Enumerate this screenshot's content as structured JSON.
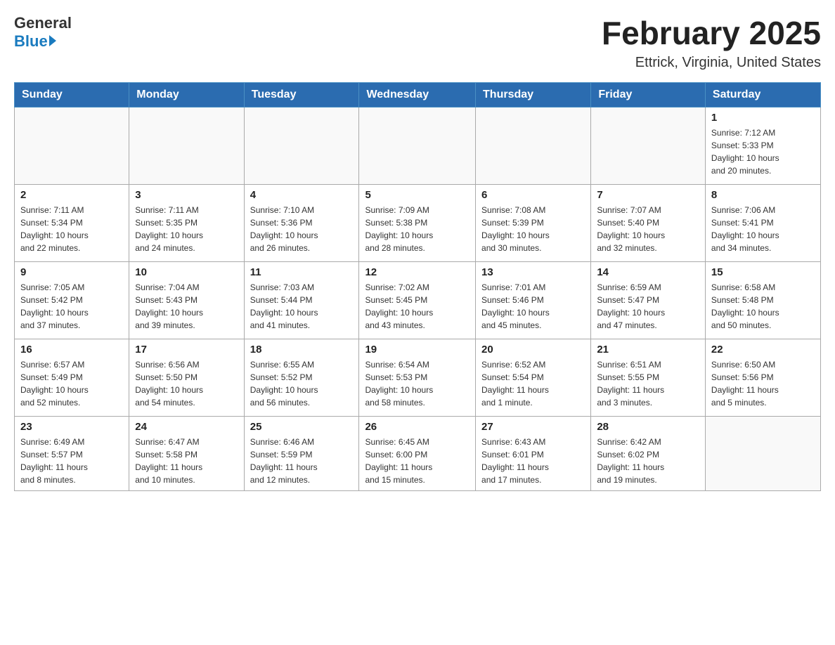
{
  "logo": {
    "general": "General",
    "blue": "Blue"
  },
  "title": "February 2025",
  "location": "Ettrick, Virginia, United States",
  "weekdays": [
    "Sunday",
    "Monday",
    "Tuesday",
    "Wednesday",
    "Thursday",
    "Friday",
    "Saturday"
  ],
  "weeks": [
    [
      {
        "day": "",
        "info": ""
      },
      {
        "day": "",
        "info": ""
      },
      {
        "day": "",
        "info": ""
      },
      {
        "day": "",
        "info": ""
      },
      {
        "day": "",
        "info": ""
      },
      {
        "day": "",
        "info": ""
      },
      {
        "day": "1",
        "info": "Sunrise: 7:12 AM\nSunset: 5:33 PM\nDaylight: 10 hours\nand 20 minutes."
      }
    ],
    [
      {
        "day": "2",
        "info": "Sunrise: 7:11 AM\nSunset: 5:34 PM\nDaylight: 10 hours\nand 22 minutes."
      },
      {
        "day": "3",
        "info": "Sunrise: 7:11 AM\nSunset: 5:35 PM\nDaylight: 10 hours\nand 24 minutes."
      },
      {
        "day": "4",
        "info": "Sunrise: 7:10 AM\nSunset: 5:36 PM\nDaylight: 10 hours\nand 26 minutes."
      },
      {
        "day": "5",
        "info": "Sunrise: 7:09 AM\nSunset: 5:38 PM\nDaylight: 10 hours\nand 28 minutes."
      },
      {
        "day": "6",
        "info": "Sunrise: 7:08 AM\nSunset: 5:39 PM\nDaylight: 10 hours\nand 30 minutes."
      },
      {
        "day": "7",
        "info": "Sunrise: 7:07 AM\nSunset: 5:40 PM\nDaylight: 10 hours\nand 32 minutes."
      },
      {
        "day": "8",
        "info": "Sunrise: 7:06 AM\nSunset: 5:41 PM\nDaylight: 10 hours\nand 34 minutes."
      }
    ],
    [
      {
        "day": "9",
        "info": "Sunrise: 7:05 AM\nSunset: 5:42 PM\nDaylight: 10 hours\nand 37 minutes."
      },
      {
        "day": "10",
        "info": "Sunrise: 7:04 AM\nSunset: 5:43 PM\nDaylight: 10 hours\nand 39 minutes."
      },
      {
        "day": "11",
        "info": "Sunrise: 7:03 AM\nSunset: 5:44 PM\nDaylight: 10 hours\nand 41 minutes."
      },
      {
        "day": "12",
        "info": "Sunrise: 7:02 AM\nSunset: 5:45 PM\nDaylight: 10 hours\nand 43 minutes."
      },
      {
        "day": "13",
        "info": "Sunrise: 7:01 AM\nSunset: 5:46 PM\nDaylight: 10 hours\nand 45 minutes."
      },
      {
        "day": "14",
        "info": "Sunrise: 6:59 AM\nSunset: 5:47 PM\nDaylight: 10 hours\nand 47 minutes."
      },
      {
        "day": "15",
        "info": "Sunrise: 6:58 AM\nSunset: 5:48 PM\nDaylight: 10 hours\nand 50 minutes."
      }
    ],
    [
      {
        "day": "16",
        "info": "Sunrise: 6:57 AM\nSunset: 5:49 PM\nDaylight: 10 hours\nand 52 minutes."
      },
      {
        "day": "17",
        "info": "Sunrise: 6:56 AM\nSunset: 5:50 PM\nDaylight: 10 hours\nand 54 minutes."
      },
      {
        "day": "18",
        "info": "Sunrise: 6:55 AM\nSunset: 5:52 PM\nDaylight: 10 hours\nand 56 minutes."
      },
      {
        "day": "19",
        "info": "Sunrise: 6:54 AM\nSunset: 5:53 PM\nDaylight: 10 hours\nand 58 minutes."
      },
      {
        "day": "20",
        "info": "Sunrise: 6:52 AM\nSunset: 5:54 PM\nDaylight: 11 hours\nand 1 minute."
      },
      {
        "day": "21",
        "info": "Sunrise: 6:51 AM\nSunset: 5:55 PM\nDaylight: 11 hours\nand 3 minutes."
      },
      {
        "day": "22",
        "info": "Sunrise: 6:50 AM\nSunset: 5:56 PM\nDaylight: 11 hours\nand 5 minutes."
      }
    ],
    [
      {
        "day": "23",
        "info": "Sunrise: 6:49 AM\nSunset: 5:57 PM\nDaylight: 11 hours\nand 8 minutes."
      },
      {
        "day": "24",
        "info": "Sunrise: 6:47 AM\nSunset: 5:58 PM\nDaylight: 11 hours\nand 10 minutes."
      },
      {
        "day": "25",
        "info": "Sunrise: 6:46 AM\nSunset: 5:59 PM\nDaylight: 11 hours\nand 12 minutes."
      },
      {
        "day": "26",
        "info": "Sunrise: 6:45 AM\nSunset: 6:00 PM\nDaylight: 11 hours\nand 15 minutes."
      },
      {
        "day": "27",
        "info": "Sunrise: 6:43 AM\nSunset: 6:01 PM\nDaylight: 11 hours\nand 17 minutes."
      },
      {
        "day": "28",
        "info": "Sunrise: 6:42 AM\nSunset: 6:02 PM\nDaylight: 11 hours\nand 19 minutes."
      },
      {
        "day": "",
        "info": ""
      }
    ]
  ]
}
